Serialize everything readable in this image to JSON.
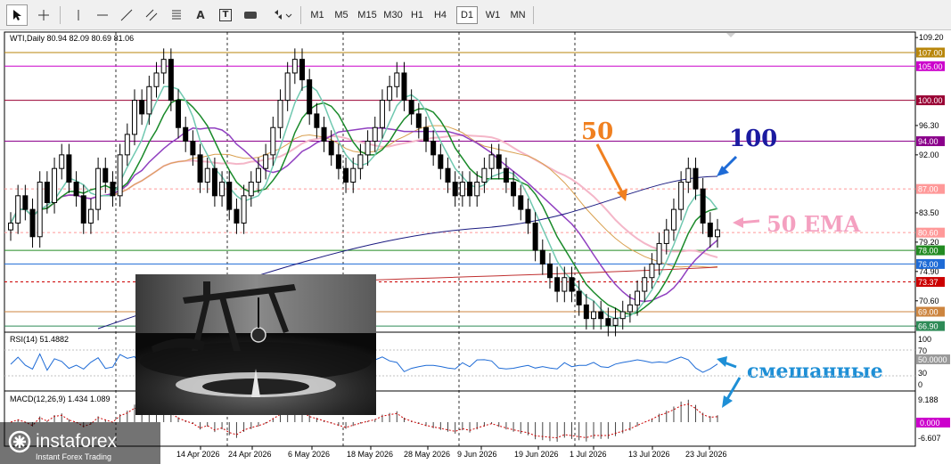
{
  "toolbar": {
    "tools": [
      {
        "name": "cursor-icon"
      },
      {
        "name": "crosshair-icon"
      },
      {
        "name": "vertical-line-icon"
      },
      {
        "name": "horizontal-line-icon"
      },
      {
        "name": "trendline-icon"
      },
      {
        "name": "channel-icon"
      },
      {
        "name": "fibonacci-icon"
      },
      {
        "name": "text-icon",
        "label": "A"
      },
      {
        "name": "text-label-icon",
        "label": "T"
      },
      {
        "name": "rectangle-icon"
      },
      {
        "name": "arrows-icon"
      }
    ],
    "timeframes": [
      "M1",
      "M5",
      "M15",
      "M30",
      "H1",
      "H4",
      "D1",
      "W1",
      "MN"
    ],
    "active_timeframe": "D1"
  },
  "main": {
    "symbol_line": "WTI,Daily  80.94 82.09 80.69 81.06"
  },
  "price_scale": [
    "109.20",
    "96.30",
    "92.00",
    "83.50",
    "79.20",
    "74.90",
    "70.60",
    "66.90"
  ],
  "price_tags": [
    {
      "text": "107.00",
      "color": "#b8860b",
      "price": 107.0
    },
    {
      "text": "105.00",
      "color": "#cc00cc",
      "price": 105.0
    },
    {
      "text": "100.00",
      "color": "#990033",
      "price": 100.0
    },
    {
      "text": "94.00",
      "color": "#8b008b",
      "price": 94.0
    },
    {
      "text": "87.00",
      "color": "#ff9999",
      "price": 87.0
    },
    {
      "text": "80.60",
      "color": "#ff9999",
      "price": 80.6
    },
    {
      "text": "78.00",
      "color": "#228b22",
      "price": 78.0
    },
    {
      "text": "76.00",
      "color": "#1e6bd6",
      "price": 76.0
    },
    {
      "text": "73.37",
      "color": "#cc0000",
      "price": 73.37
    },
    {
      "text": "69.00",
      "color": "#cd853f",
      "price": 69.0
    },
    {
      "text": "66.90",
      "color": "#2e8b57",
      "price": 66.9
    }
  ],
  "annotations": {
    "label_50": "50",
    "label_100": "100",
    "label_50ema": "50 EMA",
    "label_mixed": "смешанные"
  },
  "rsi": {
    "title": "RSI(14) 51.4882",
    "scale": [
      "100",
      "70",
      "30",
      "0"
    ],
    "tag": "50.0000"
  },
  "macd": {
    "title": "MACD(12,26,9) 1.434 1.089",
    "scale_top": "9.188",
    "scale_bottom": "-6.607",
    "tag": "0.000"
  },
  "time_axis": [
    "14 Apr 2026",
    "24 Apr 2026",
    "6 May 2026",
    "18 May 2026",
    "28 May 2026",
    "9 Jun 2026",
    "19 Jun 2026",
    "1 Jul 2026",
    "13 Jul 2026",
    "23 Jul 2026"
  ],
  "watermark": {
    "brand": "instaforex",
    "tagline": "Instant Forex Trading"
  },
  "chart_data": {
    "type": "line",
    "candles_close": [
      82,
      86,
      84,
      80,
      88,
      85,
      90,
      92,
      88,
      86,
      82,
      84,
      90,
      88,
      86,
      92,
      95,
      100,
      98,
      102,
      104,
      106,
      100,
      96,
      94,
      92,
      88,
      90,
      86,
      88,
      84,
      82,
      86,
      88,
      90,
      92,
      96,
      100,
      104,
      106,
      103,
      98,
      96,
      94,
      92,
      90,
      88,
      90,
      92,
      94,
      96,
      100,
      102,
      104,
      100,
      98,
      96,
      94,
      92,
      90,
      88,
      86,
      88,
      86,
      88,
      90,
      92,
      90,
      88,
      86,
      84,
      82,
      78,
      76,
      74,
      72,
      74,
      72,
      70,
      68,
      69,
      68,
      67,
      68,
      69,
      70,
      72,
      74,
      76,
      79,
      81,
      84,
      88,
      90,
      87,
      82,
      80,
      81
    ],
    "ylim": [
      66,
      110
    ]
  }
}
